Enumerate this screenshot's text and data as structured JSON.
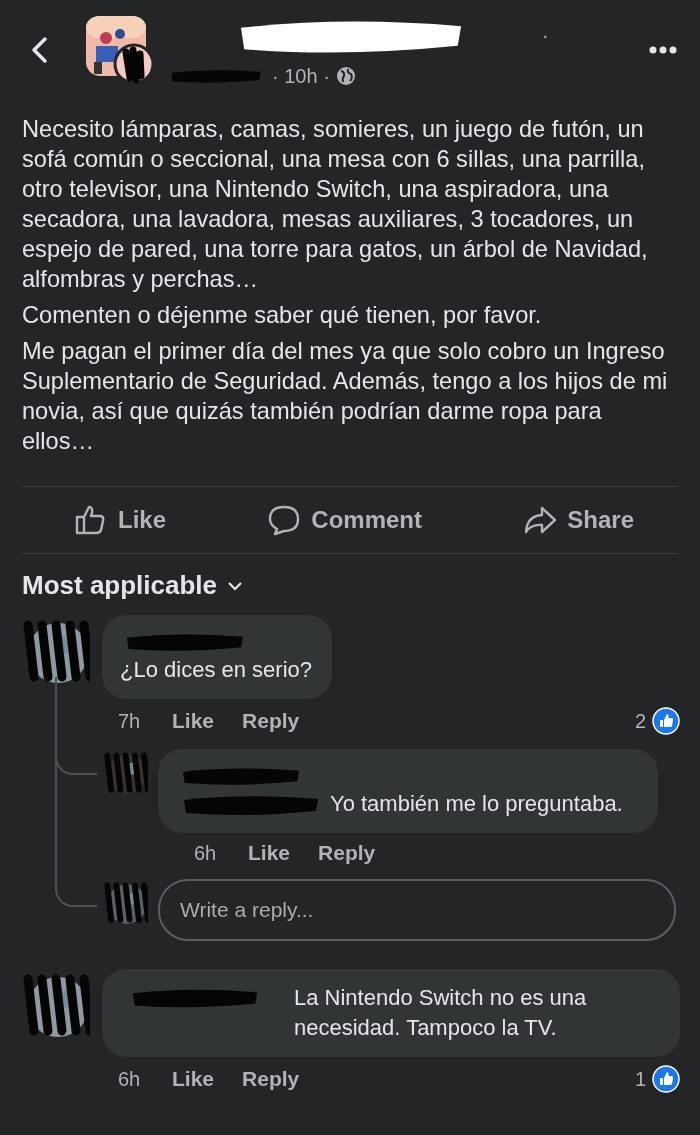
{
  "header": {
    "name_suffix": "·",
    "meta": "· 10h ·"
  },
  "post": {
    "paragraphs": [
      "Necesito lámparas, camas, somieres, un juego de futón, un sofá común o seccional, una mesa con 6 sillas, una parrilla, otro televisor, una Nintendo Switch, una aspiradora, una secadora, una lavadora, mesas auxiliares, 3 tocadores, un espejo de pared, una torre para gatos, un árbol de Navidad, alfombras y perchas…",
      "Comenten o déjenme saber qué tienen, por favor.",
      "Me pagan el primer día del mes ya que solo cobro un Ingreso Suplementario de Seguridad. Además, tengo a los hijos de mi novia, así que quizás también podrían darme ropa para ellos…"
    ]
  },
  "actions": [
    {
      "kind": "like",
      "label": "Like"
    },
    {
      "kind": "comment",
      "label": "Comment"
    },
    {
      "kind": "share",
      "label": "Share"
    }
  ],
  "sort": {
    "label": "Most applicable"
  },
  "comments": [
    {
      "kind": "stacked",
      "text": "¿Lo dices en serio?",
      "time": "7h",
      "like": "Like",
      "reply": "Reply",
      "reactions": "2",
      "replies": [
        {
          "kind": "stacked",
          "text": "Yo también me lo preguntaba.",
          "time": "6h",
          "like": "Like",
          "reply": "Reply"
        }
      ],
      "reply_field": {
        "placeholder": "Write a reply..."
      }
    },
    {
      "kind": "inline",
      "text": "La Nintendo Switch no es una necesidad. Tampoco la TV.",
      "time": "6h",
      "like": "Like",
      "reply": "Reply",
      "reactions": "1"
    }
  ]
}
